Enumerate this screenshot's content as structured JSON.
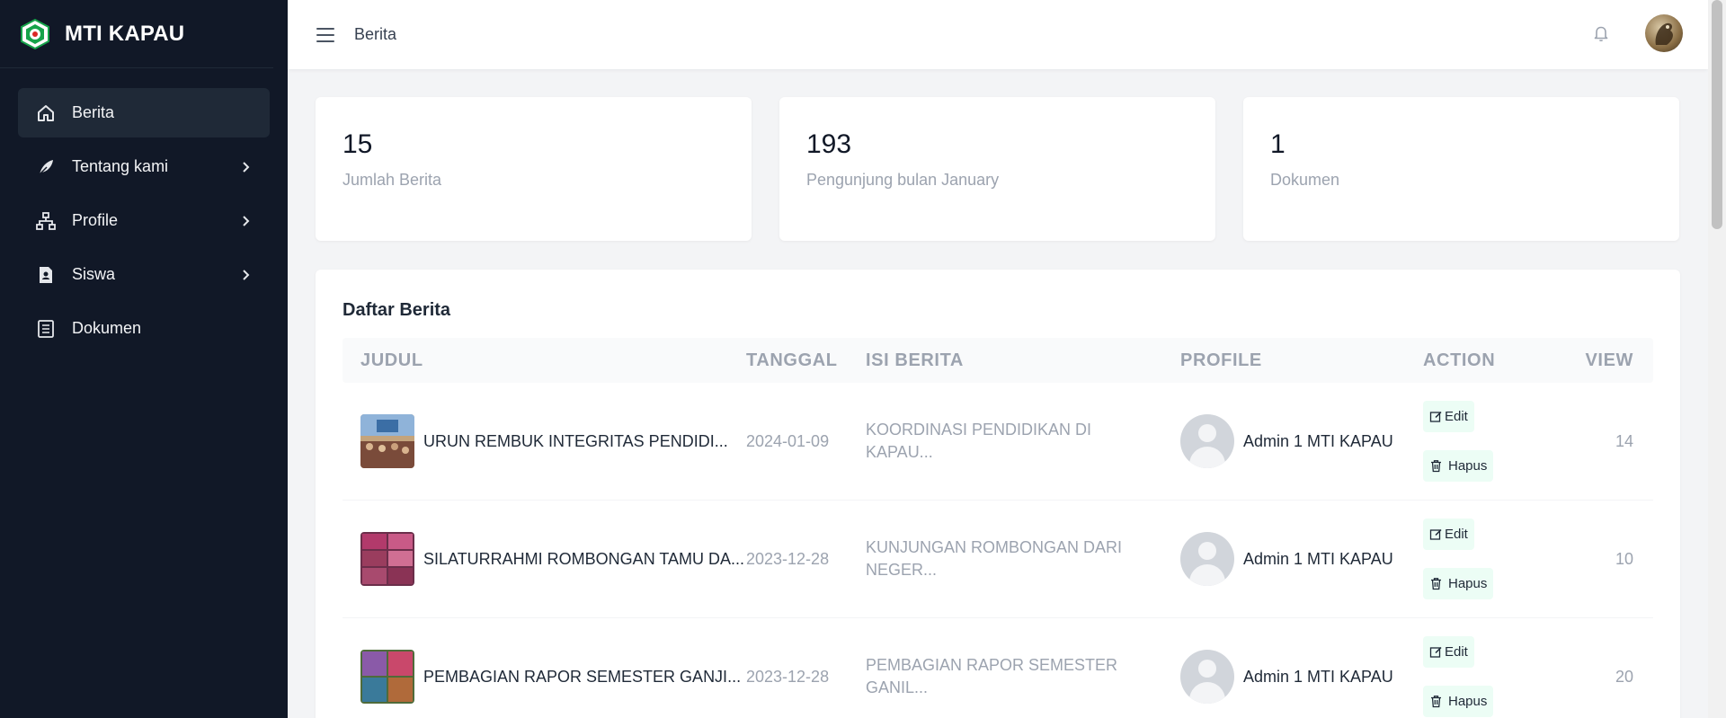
{
  "sidebar": {
    "brand": "MTI KAPAU",
    "items": [
      {
        "label": "Berita",
        "icon": "home-icon",
        "active": true,
        "has_children": false
      },
      {
        "label": "Tentang kami",
        "icon": "feather-icon",
        "active": false,
        "has_children": true
      },
      {
        "label": "Profile",
        "icon": "sitemap-icon",
        "active": false,
        "has_children": true
      },
      {
        "label": "Siswa",
        "icon": "id-card-icon",
        "active": false,
        "has_children": true
      },
      {
        "label": "Dokumen",
        "icon": "document-list-icon",
        "active": false,
        "has_children": false
      }
    ]
  },
  "topbar": {
    "title": "Berita"
  },
  "stats": [
    {
      "value": "15",
      "label": "Jumlah Berita"
    },
    {
      "value": "193",
      "label": "Pengunjung bulan January"
    },
    {
      "value": "1",
      "label": "Dokumen"
    }
  ],
  "table": {
    "title": "Daftar Berita",
    "headers": {
      "judul": "JUDUL",
      "tanggal": "TANGGAL",
      "isi": "ISI BERITA",
      "profile": "PROFILE",
      "action": "ACTION",
      "view": "VIEW"
    },
    "rows": [
      {
        "judul": "URUN REMBUK INTEGRITAS PENDIDI...",
        "tanggal": "2024-01-09",
        "isi": "KOORDINASI PENDIDIKAN DI KAPAU...",
        "profile": "Admin 1 MTI KAPAU",
        "edit": "Edit",
        "hapus": "Hapus",
        "view": "14"
      },
      {
        "judul": "SILATURRAHMI ROMBONGAN TAMU DA...",
        "tanggal": "2023-12-28",
        "isi": "KUNJUNGAN ROMBONGAN DARI NEGER...",
        "profile": "Admin 1 MTI KAPAU",
        "edit": "Edit",
        "hapus": "Hapus",
        "view": "10"
      },
      {
        "judul": "PEMBAGIAN RAPOR SEMESTER GANJI...",
        "tanggal": "2023-12-28",
        "isi": "PEMBAGIAN RAPOR SEMESTER GANIL...",
        "profile": "Admin 1 MTI KAPAU",
        "edit": "Edit",
        "hapus": "Hapus",
        "view": "20"
      }
    ]
  },
  "colors": {
    "sidebar_bg": "#111827",
    "sidebar_active": "#1f2937",
    "page_bg": "#f3f4f6",
    "action_btn_bg": "#ecfdf5",
    "muted_text": "#9ca3af"
  }
}
